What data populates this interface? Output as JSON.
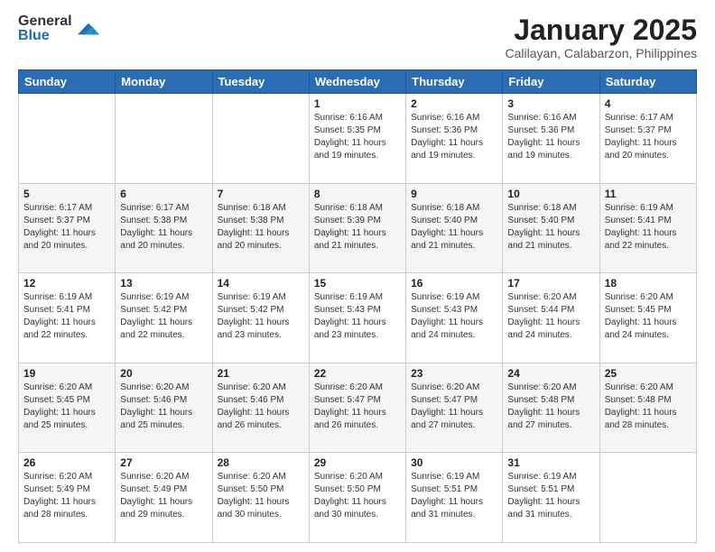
{
  "logo": {
    "general": "General",
    "blue": "Blue"
  },
  "title": {
    "month": "January 2025",
    "location": "Calilayan, Calabarzon, Philippines"
  },
  "days_header": [
    "Sunday",
    "Monday",
    "Tuesday",
    "Wednesday",
    "Thursday",
    "Friday",
    "Saturday"
  ],
  "weeks": [
    [
      {
        "day": "",
        "info": ""
      },
      {
        "day": "",
        "info": ""
      },
      {
        "day": "",
        "info": ""
      },
      {
        "day": "1",
        "info": "Sunrise: 6:16 AM\nSunset: 5:35 PM\nDaylight: 11 hours and 19 minutes."
      },
      {
        "day": "2",
        "info": "Sunrise: 6:16 AM\nSunset: 5:36 PM\nDaylight: 11 hours and 19 minutes."
      },
      {
        "day": "3",
        "info": "Sunrise: 6:16 AM\nSunset: 5:36 PM\nDaylight: 11 hours and 19 minutes."
      },
      {
        "day": "4",
        "info": "Sunrise: 6:17 AM\nSunset: 5:37 PM\nDaylight: 11 hours and 20 minutes."
      }
    ],
    [
      {
        "day": "5",
        "info": "Sunrise: 6:17 AM\nSunset: 5:37 PM\nDaylight: 11 hours and 20 minutes."
      },
      {
        "day": "6",
        "info": "Sunrise: 6:17 AM\nSunset: 5:38 PM\nDaylight: 11 hours and 20 minutes."
      },
      {
        "day": "7",
        "info": "Sunrise: 6:18 AM\nSunset: 5:38 PM\nDaylight: 11 hours and 20 minutes."
      },
      {
        "day": "8",
        "info": "Sunrise: 6:18 AM\nSunset: 5:39 PM\nDaylight: 11 hours and 21 minutes."
      },
      {
        "day": "9",
        "info": "Sunrise: 6:18 AM\nSunset: 5:40 PM\nDaylight: 11 hours and 21 minutes."
      },
      {
        "day": "10",
        "info": "Sunrise: 6:18 AM\nSunset: 5:40 PM\nDaylight: 11 hours and 21 minutes."
      },
      {
        "day": "11",
        "info": "Sunrise: 6:19 AM\nSunset: 5:41 PM\nDaylight: 11 hours and 22 minutes."
      }
    ],
    [
      {
        "day": "12",
        "info": "Sunrise: 6:19 AM\nSunset: 5:41 PM\nDaylight: 11 hours and 22 minutes."
      },
      {
        "day": "13",
        "info": "Sunrise: 6:19 AM\nSunset: 5:42 PM\nDaylight: 11 hours and 22 minutes."
      },
      {
        "day": "14",
        "info": "Sunrise: 6:19 AM\nSunset: 5:42 PM\nDaylight: 11 hours and 23 minutes."
      },
      {
        "day": "15",
        "info": "Sunrise: 6:19 AM\nSunset: 5:43 PM\nDaylight: 11 hours and 23 minutes."
      },
      {
        "day": "16",
        "info": "Sunrise: 6:19 AM\nSunset: 5:43 PM\nDaylight: 11 hours and 24 minutes."
      },
      {
        "day": "17",
        "info": "Sunrise: 6:20 AM\nSunset: 5:44 PM\nDaylight: 11 hours and 24 minutes."
      },
      {
        "day": "18",
        "info": "Sunrise: 6:20 AM\nSunset: 5:45 PM\nDaylight: 11 hours and 24 minutes."
      }
    ],
    [
      {
        "day": "19",
        "info": "Sunrise: 6:20 AM\nSunset: 5:45 PM\nDaylight: 11 hours and 25 minutes."
      },
      {
        "day": "20",
        "info": "Sunrise: 6:20 AM\nSunset: 5:46 PM\nDaylight: 11 hours and 25 minutes."
      },
      {
        "day": "21",
        "info": "Sunrise: 6:20 AM\nSunset: 5:46 PM\nDaylight: 11 hours and 26 minutes."
      },
      {
        "day": "22",
        "info": "Sunrise: 6:20 AM\nSunset: 5:47 PM\nDaylight: 11 hours and 26 minutes."
      },
      {
        "day": "23",
        "info": "Sunrise: 6:20 AM\nSunset: 5:47 PM\nDaylight: 11 hours and 27 minutes."
      },
      {
        "day": "24",
        "info": "Sunrise: 6:20 AM\nSunset: 5:48 PM\nDaylight: 11 hours and 27 minutes."
      },
      {
        "day": "25",
        "info": "Sunrise: 6:20 AM\nSunset: 5:48 PM\nDaylight: 11 hours and 28 minutes."
      }
    ],
    [
      {
        "day": "26",
        "info": "Sunrise: 6:20 AM\nSunset: 5:49 PM\nDaylight: 11 hours and 28 minutes."
      },
      {
        "day": "27",
        "info": "Sunrise: 6:20 AM\nSunset: 5:49 PM\nDaylight: 11 hours and 29 minutes."
      },
      {
        "day": "28",
        "info": "Sunrise: 6:20 AM\nSunset: 5:50 PM\nDaylight: 11 hours and 30 minutes."
      },
      {
        "day": "29",
        "info": "Sunrise: 6:20 AM\nSunset: 5:50 PM\nDaylight: 11 hours and 30 minutes."
      },
      {
        "day": "30",
        "info": "Sunrise: 6:19 AM\nSunset: 5:51 PM\nDaylight: 11 hours and 31 minutes."
      },
      {
        "day": "31",
        "info": "Sunrise: 6:19 AM\nSunset: 5:51 PM\nDaylight: 11 hours and 31 minutes."
      },
      {
        "day": "",
        "info": ""
      }
    ]
  ]
}
